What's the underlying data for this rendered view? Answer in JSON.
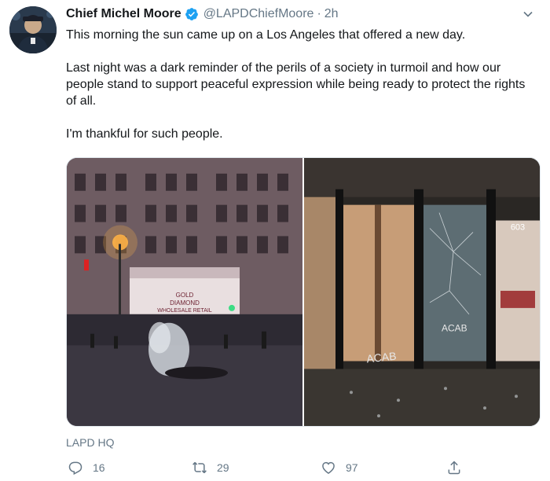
{
  "tweet": {
    "author_name": "Chief Michel Moore",
    "author_handle": "@LAPDChiefMoore",
    "separator": "·",
    "timestamp": "2h",
    "paragraphs": [
      "This morning the sun came up on a Los Angeles that offered a new day.",
      "Last night was a dark reminder of the perils of a society in turmoil and how our people stand to support peaceful expression while being ready to protect the rights of all.",
      "I'm thankful for such people."
    ],
    "location": "LAPD HQ",
    "counts": {
      "replies": "16",
      "retweets": "29",
      "likes": "97"
    }
  },
  "icons": {
    "verified": "verified-badge-icon",
    "menu": "chevron-down-icon",
    "reply": "reply-icon",
    "retweet": "retweet-icon",
    "like": "heart-icon",
    "share": "share-icon"
  },
  "colors": {
    "text_primary": "#14171a",
    "text_secondary": "#657786",
    "verified_blue": "#1da1f2",
    "border": "#e1e8ed"
  },
  "photos": {
    "left_sign_lines": [
      "GOLD",
      "DIAMOND",
      "WHOLESALE RETAIL"
    ],
    "right_number": "603",
    "right_graffiti": [
      "ACAB",
      "ACAB"
    ]
  }
}
